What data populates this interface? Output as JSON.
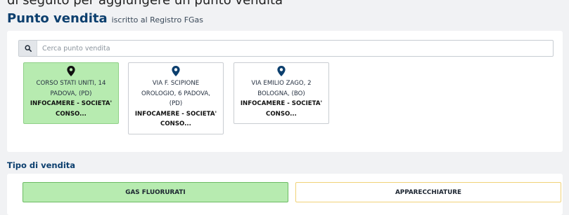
{
  "top_fragment": "di seguito per aggiungere un punto vendita",
  "header": {
    "title": "Punto vendita",
    "subtitle": "iscritto al Registro FGas"
  },
  "search": {
    "placeholder": "Cerca punto vendita",
    "value": ""
  },
  "cards": [
    {
      "selected": true,
      "address": [
        "CORSO STATI UNITI, 14",
        "PADOVA, (PD)"
      ],
      "name": [
        "INFOCAMERE - SOCIETA'",
        "CONSO..."
      ]
    },
    {
      "selected": false,
      "address": [
        "VIA F. SCIPIONE",
        "OROLOGIO, 6 PADOVA,",
        "(PD)"
      ],
      "name": [
        "INFOCAMERE - SOCIETA'",
        "CONSO..."
      ]
    },
    {
      "selected": false,
      "address": [
        "VIA EMILIO ZAGO, 2",
        "BOLOGNA, (BO)"
      ],
      "name": [
        "INFOCAMERE - SOCIETA'",
        "CONSO..."
      ]
    }
  ],
  "tipo_vendita": {
    "title": "Tipo di vendita",
    "options": [
      {
        "label": "GAS FLUORURATI",
        "selected": true
      },
      {
        "label": "APPARECCHIATURE",
        "selected": false
      }
    ]
  },
  "colors": {
    "brand": "#0c3f6e",
    "selected_green": "#b7ebb0",
    "selected_border": "#6cbb63",
    "unselected_border": "#f1d277"
  },
  "icons": {
    "search": "search-icon",
    "location": "map-pin-icon"
  }
}
